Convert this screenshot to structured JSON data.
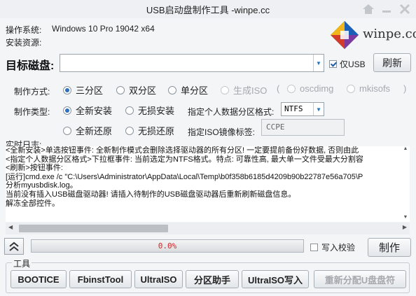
{
  "window": {
    "title": "USB启动盘制作工具 -winpe.cc"
  },
  "title_icons": [
    "home-icon",
    "minimize-icon",
    "close-icon"
  ],
  "info": {
    "os_label": "操作系统:",
    "os_value": "Windows 10 Pro 19042 x64",
    "source_label": "安装资源:"
  },
  "logo": {
    "text": "winpe.cc"
  },
  "disk": {
    "label": "目标磁盘:",
    "value": "",
    "usb_only_label": "仅USB",
    "usb_only_checked": true,
    "refresh_label": "刷新"
  },
  "method": {
    "label": "制作方式:",
    "options": [
      "三分区",
      "双分区",
      "单分区",
      "生成ISO"
    ],
    "selected": "三分区",
    "paren_open": "(",
    "paren_close": ")",
    "iso_options": [
      "oscdimg",
      "mkisofs"
    ]
  },
  "type": {
    "label": "制作类型:",
    "options_row1": [
      "全新安装",
      "无损安装"
    ],
    "options_row2": [
      "全新还原",
      "无损还原"
    ],
    "selected": "全新安装",
    "format_label": "指定个人数据分区格式:",
    "format_value": "NTFS",
    "iso_label_label": "指定ISO镜像标签:",
    "iso_label_value": "CCPE"
  },
  "log": {
    "label": "实时日志:",
    "lines": [
      "<全新安装>单选按钮事件: 全新制作模式会删除选择驱动器的所有分区! 一定要提前备份好数据, 否则由此",
      "<指定个人数据分区格式>下拉框事件: 当前选定为NTFS格式。特点: 可靠性高, 最大单一文件受最大分割容",
      "<刷新>按钮事件:",
      "[运行]cmd.exe /c \"C:\\Users\\Administrator\\AppData\\Local\\Temp\\b0f358b6185d4209b90b22787e56a705\\P",
      "分析myusbdisk.log。",
      "当前没有插入USB磁盘驱动器! 请插入待制作的USB磁盘驱动器后重新刷新磁盘信息。",
      "解冻全部控件。"
    ]
  },
  "progress": {
    "value": 0,
    "text": "0.0%"
  },
  "verify": {
    "label": "写入校验",
    "checked": false
  },
  "make_button": "制作",
  "tools": {
    "label": "工具",
    "buttons": [
      "BOOTICE",
      "FbinstTool",
      "UltraISO",
      "分区助手",
      "UltraISO写入",
      "重新分配U盘盘符"
    ]
  }
}
